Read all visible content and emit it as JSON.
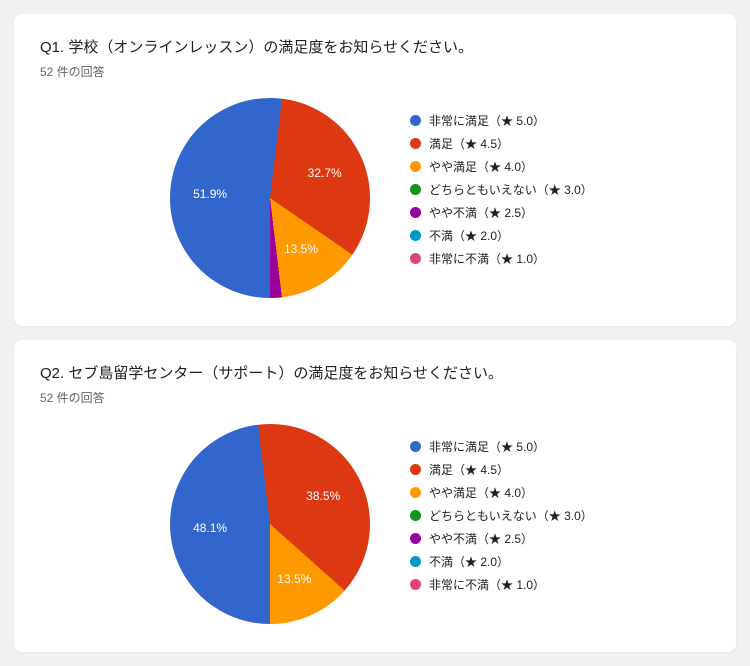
{
  "charts": [
    {
      "title": "Q1. 学校（オンラインレッスン）の満足度をお知らせください。",
      "subtitle": "52 件の回答",
      "legend": [
        {
          "label": "非常に満足（★ 5.0）",
          "color": "#3366cc"
        },
        {
          "label": "満足（★ 4.5）",
          "color": "#dc3912"
        },
        {
          "label": "やや満足（★ 4.0）",
          "color": "#ff9900"
        },
        {
          "label": "どちらともいえない（★ 3.0）",
          "color": "#109618"
        },
        {
          "label": "やや不満（★ 2.5）",
          "color": "#990099"
        },
        {
          "label": "不満（★ 2.0）",
          "color": "#0099c6"
        },
        {
          "label": "非常に不満（★ 1.0）",
          "color": "#dd4477"
        }
      ],
      "slices": [
        {
          "value": 51.9,
          "color": "#3366cc",
          "label": "51.9%"
        },
        {
          "value": 32.7,
          "color": "#dc3912",
          "label": "32.7%"
        },
        {
          "value": 13.5,
          "color": "#ff9900",
          "label": "13.5%"
        },
        {
          "value": 0,
          "color": "#109618",
          "label": ""
        },
        {
          "value": 1.9,
          "color": "#990099",
          "label": ""
        },
        {
          "value": 0,
          "color": "#0099c6",
          "label": ""
        },
        {
          "value": 0,
          "color": "#dd4477",
          "label": ""
        }
      ],
      "labelsShown": [
        "51.9%",
        "32.7%",
        "13.5%"
      ]
    },
    {
      "title": "Q2. セブ島留学センター（サポート）の満足度をお知らせください。",
      "subtitle": "52 件の回答",
      "legend": [
        {
          "label": "非常に満足（★ 5.0）",
          "color": "#3366cc"
        },
        {
          "label": "満足（★ 4.5）",
          "color": "#dc3912"
        },
        {
          "label": "やや満足（★ 4.0）",
          "color": "#ff9900"
        },
        {
          "label": "どちらともいえない（★ 3.0）",
          "color": "#109618"
        },
        {
          "label": "やや不満（★ 2.5）",
          "color": "#990099"
        },
        {
          "label": "不満（★ 2.0）",
          "color": "#0099c6"
        },
        {
          "label": "非常に不満（★ 1.0）",
          "color": "#dd4477"
        }
      ],
      "slices": [
        {
          "value": 48.1,
          "color": "#3366cc",
          "label": "48.1%"
        },
        {
          "value": 38.5,
          "color": "#dc3912",
          "label": "38.5%"
        },
        {
          "value": 13.5,
          "color": "#ff9900",
          "label": "13.5%"
        },
        {
          "value": 0,
          "color": "#109618",
          "label": ""
        },
        {
          "value": 0,
          "color": "#990099",
          "label": ""
        },
        {
          "value": 0,
          "color": "#0099c6",
          "label": ""
        },
        {
          "value": 0,
          "color": "#dd4477",
          "label": ""
        }
      ],
      "labelsShown": [
        "48.1%",
        "38.5%",
        "13.5%"
      ]
    }
  ],
  "chart_data": [
    {
      "type": "pie",
      "title": "Q1. 学校（オンラインレッスン）の満足度をお知らせください。",
      "n_responses": 52,
      "categories": [
        "非常に満足（★ 5.0）",
        "満足（★ 4.5）",
        "やや満足（★ 4.0）",
        "どちらともいえない（★ 3.0）",
        "やや不満（★ 2.5）",
        "不満（★ 2.0）",
        "非常に不満（★ 1.0）"
      ],
      "values": [
        51.9,
        32.7,
        13.5,
        0,
        1.9,
        0,
        0
      ],
      "value_unit": "percent"
    },
    {
      "type": "pie",
      "title": "Q2. セブ島留学センター（サポート）の満足度をお知らせください。",
      "n_responses": 52,
      "categories": [
        "非常に満足（★ 5.0）",
        "満足（★ 4.5）",
        "やや満足（★ 4.0）",
        "どちらともいえない（★ 3.0）",
        "やや不満（★ 2.5）",
        "不満（★ 2.0）",
        "非常に不満（★ 1.0）"
      ],
      "values": [
        48.1,
        38.5,
        13.5,
        0,
        0,
        0,
        0
      ],
      "value_unit": "percent"
    }
  ]
}
